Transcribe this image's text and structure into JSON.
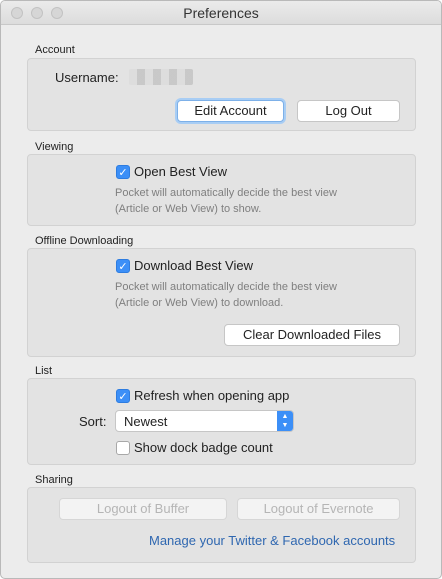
{
  "window": {
    "title": "Preferences"
  },
  "account": {
    "section_label": "Account",
    "username_label": "Username:",
    "edit_button": "Edit Account",
    "logout_button": "Log Out"
  },
  "viewing": {
    "section_label": "Viewing",
    "checkbox_label": "Open Best View",
    "checked": true,
    "hint_line1": "Pocket will automatically decide the best view",
    "hint_line2": "(Article or Web View) to show."
  },
  "offline": {
    "section_label": "Offline Downloading",
    "checkbox_label": "Download Best View",
    "checked": true,
    "hint_line1": "Pocket will automatically decide the best view",
    "hint_line2": "(Article or Web View) to download.",
    "clear_button": "Clear Downloaded Files"
  },
  "list": {
    "section_label": "List",
    "refresh_label": "Refresh when opening app",
    "refresh_checked": true,
    "sort_label": "Sort:",
    "sort_value": "Newest",
    "badge_label": "Show dock badge count",
    "badge_checked": false
  },
  "sharing": {
    "section_label": "Sharing",
    "buffer_button": "Logout of Buffer",
    "evernote_button": "Logout of Evernote",
    "manage_link": "Manage your Twitter & Facebook accounts"
  },
  "colors": {
    "accent": "#3c8ff7",
    "link": "#2f67b0"
  }
}
